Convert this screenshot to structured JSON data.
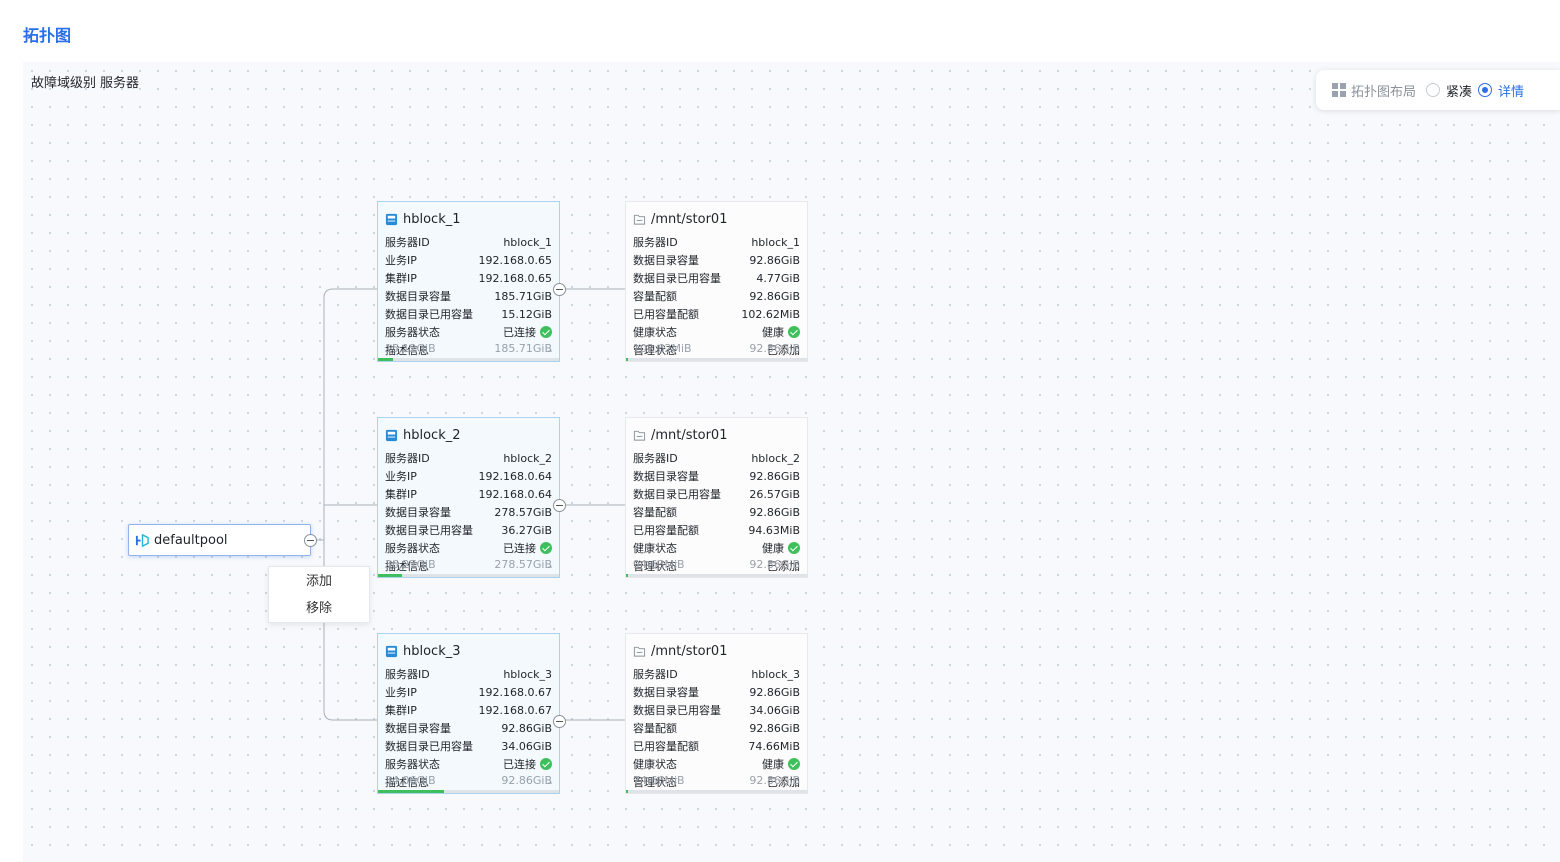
{
  "page": {
    "title": "拓扑图"
  },
  "fault_domain": {
    "label": "故障域级别",
    "value": "服务器"
  },
  "layout_panel": {
    "title": "拓扑图布局",
    "options": [
      "紧凑",
      "详情"
    ],
    "selected": "详情"
  },
  "pool": {
    "name": "defaultpool"
  },
  "context_menu": {
    "items": [
      "添加",
      "移除"
    ]
  },
  "servers": [
    {
      "name": "hblock_1",
      "rows": [
        {
          "label": "服务器ID",
          "value": "hblock_1"
        },
        {
          "label": "业务IP",
          "value": "192.168.0.65"
        },
        {
          "label": "集群IP",
          "value": "192.168.0.65"
        },
        {
          "label": "数据目录容量",
          "value": "185.71GiB"
        },
        {
          "label": "数据目录已用容量",
          "value": "15.12GiB"
        },
        {
          "label": "服务器状态",
          "value": "已连接",
          "ok": true
        },
        {
          "label": "描述信息",
          "value": "-"
        }
      ],
      "used": "15.12GiB",
      "total": "185.71GiB",
      "usage_fraction": 0.081
    },
    {
      "name": "hblock_2",
      "rows": [
        {
          "label": "服务器ID",
          "value": "hblock_2"
        },
        {
          "label": "业务IP",
          "value": "192.168.0.64"
        },
        {
          "label": "集群IP",
          "value": "192.168.0.64"
        },
        {
          "label": "数据目录容量",
          "value": "278.57GiB"
        },
        {
          "label": "数据目录已用容量",
          "value": "36.27GiB"
        },
        {
          "label": "服务器状态",
          "value": "已连接",
          "ok": true
        },
        {
          "label": "描述信息",
          "value": "-"
        }
      ],
      "used": "36.27GiB",
      "total": "278.57GiB",
      "usage_fraction": 0.13
    },
    {
      "name": "hblock_3",
      "rows": [
        {
          "label": "服务器ID",
          "value": "hblock_3"
        },
        {
          "label": "业务IP",
          "value": "192.168.0.67"
        },
        {
          "label": "集群IP",
          "value": "192.168.0.67"
        },
        {
          "label": "数据目录容量",
          "value": "92.86GiB"
        },
        {
          "label": "数据目录已用容量",
          "value": "34.06GiB"
        },
        {
          "label": "服务器状态",
          "value": "已连接",
          "ok": true
        },
        {
          "label": "描述信息",
          "value": "-"
        }
      ],
      "used": "34.06GiB",
      "total": "92.86GiB",
      "usage_fraction": 0.367
    }
  ],
  "dirs": [
    {
      "name": "/mnt/stor01",
      "rows": [
        {
          "label": "服务器ID",
          "value": "hblock_1"
        },
        {
          "label": "数据目录容量",
          "value": "92.86GiB"
        },
        {
          "label": "数据目录已用容量",
          "value": "4.77GiB"
        },
        {
          "label": "容量配额",
          "value": "92.86GiB"
        },
        {
          "label": "已用容量配额",
          "value": "102.62MiB"
        },
        {
          "label": "健康状态",
          "value": "健康",
          "ok": true
        },
        {
          "label": "管理状态",
          "value": "已添加"
        }
      ],
      "used": "102.62MiB",
      "total": "92.86GiB",
      "usage_fraction": 0.011
    },
    {
      "name": "/mnt/stor01",
      "rows": [
        {
          "label": "服务器ID",
          "value": "hblock_2"
        },
        {
          "label": "数据目录容量",
          "value": "92.86GiB"
        },
        {
          "label": "数据目录已用容量",
          "value": "26.57GiB"
        },
        {
          "label": "容量配额",
          "value": "92.86GiB"
        },
        {
          "label": "已用容量配额",
          "value": "94.63MiB"
        },
        {
          "label": "健康状态",
          "value": "健康",
          "ok": true
        },
        {
          "label": "管理状态",
          "value": "已添加"
        }
      ],
      "used": "94.63MiB",
      "total": "92.86GiB",
      "usage_fraction": 0.01
    },
    {
      "name": "/mnt/stor01",
      "rows": [
        {
          "label": "服务器ID",
          "value": "hblock_3"
        },
        {
          "label": "数据目录容量",
          "value": "92.86GiB"
        },
        {
          "label": "数据目录已用容量",
          "value": "34.06GiB"
        },
        {
          "label": "容量配额",
          "value": "92.86GiB"
        },
        {
          "label": "已用容量配额",
          "value": "74.66MiB"
        },
        {
          "label": "健康状态",
          "value": "健康",
          "ok": true
        },
        {
          "label": "管理状态",
          "value": "已添加"
        }
      ],
      "used": "74.66MiB",
      "total": "92.86GiB",
      "usage_fraction": 0.008
    }
  ],
  "colors": {
    "accent": "#2b6fe6",
    "ok": "#3fbf5b",
    "server_bg": "#f3f9fd",
    "server_border": "#a9d3ef"
  }
}
